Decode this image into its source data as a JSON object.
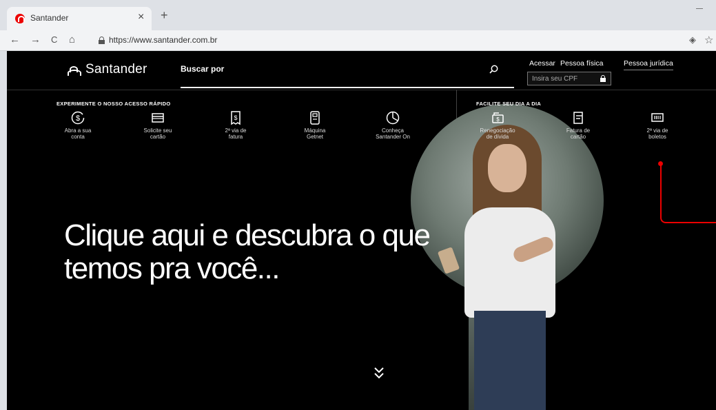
{
  "browser": {
    "tab_title": "Santander",
    "tab_close": "×",
    "new_tab": "+",
    "url": "https://www.santander.com.br",
    "nav": {
      "back": "←",
      "forward": "→",
      "reload": "C",
      "home": "⌂"
    },
    "location_icon": "◈",
    "bookmark_icon": "☆"
  },
  "header": {
    "logo_text": "Santander",
    "search_label": "Buscar por",
    "access_label": "Acessar",
    "person_type": "Pessoa física",
    "cpf_placeholder": "Insira seu CPF",
    "business_link": "Pessoa jurídica"
  },
  "quick_access": {
    "title": "EXPERIMENTE O NOSSO ACESSO RÁPIDO",
    "items": [
      {
        "label": "Abra a sua\nconta",
        "icon": "dollar-cycle-icon"
      },
      {
        "label": "Solicite seu\ncartão",
        "icon": "card-icon"
      },
      {
        "label": "2ª via de\nfatura",
        "icon": "invoice-icon"
      },
      {
        "label": "Máquina\nGetnet",
        "icon": "pos-machine-icon"
      },
      {
        "label": "Conheça\nSantander On",
        "icon": "pie-chart-icon"
      }
    ]
  },
  "daily": {
    "title": "FACILITE SEU DIA A DIA",
    "items": [
      {
        "label": "Renegociação\nde dívida",
        "icon": "renegotiation-icon"
      },
      {
        "label": "Fatura de\ncartão",
        "icon": "card-bill-icon"
      },
      {
        "label": "2ª via de\nboletos",
        "icon": "barcode-icon"
      }
    ]
  },
  "hero": {
    "headline": "Clique aqui e descubra o que\ntemos pra você..."
  },
  "colors": {
    "brand_red": "#ec0000",
    "background": "#000000"
  }
}
